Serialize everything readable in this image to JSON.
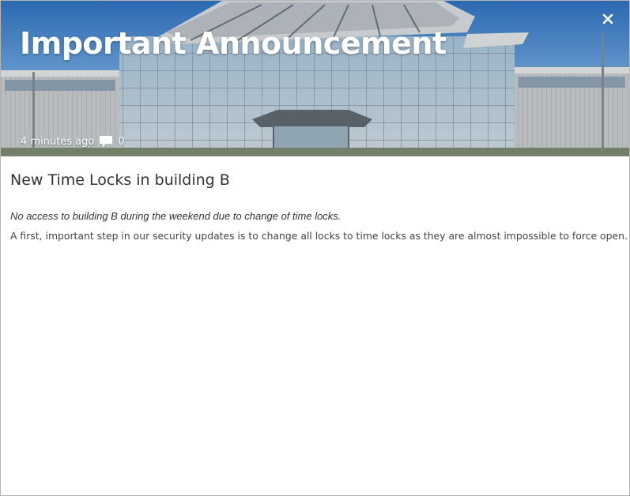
{
  "dialog": {
    "title": "Important Announcement",
    "close_icon": "close-icon"
  },
  "meta": {
    "time_ago": "4 minutes ago",
    "comment_icon": "comment-icon",
    "comment_count": "0"
  },
  "article": {
    "title": "New Time Locks in building B",
    "lead": "No access to building B during the weekend due to change of time locks.",
    "body": "A first, important step in our security updates is to change all locks to time locks as they are almost impossible to force open."
  }
}
